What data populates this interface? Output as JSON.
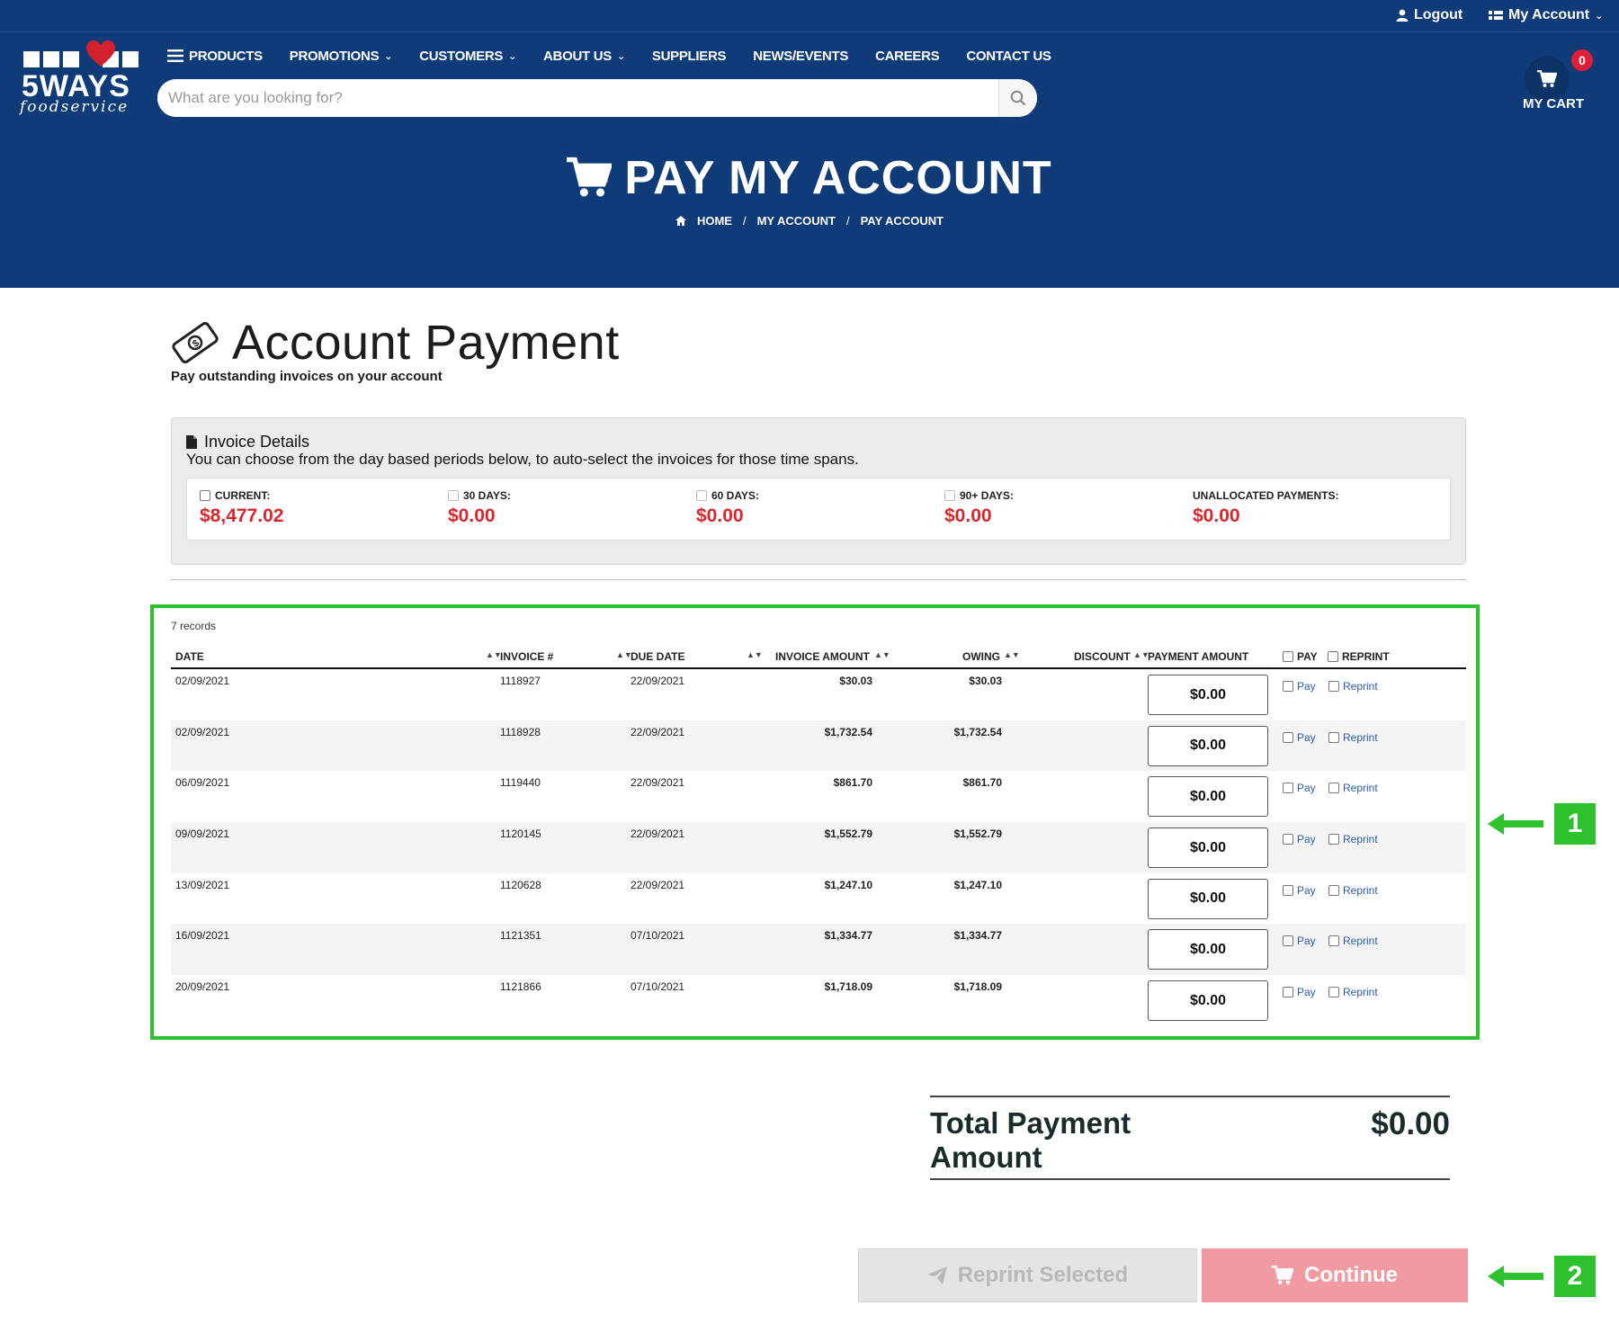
{
  "topbar": {
    "logout": "Logout",
    "my_account": "My Account"
  },
  "logo": {
    "brand": "5WAYS",
    "sub": "foodservice"
  },
  "nav": [
    {
      "label": "PRODUCTS",
      "menu": true,
      "dropdown": false
    },
    {
      "label": "PROMOTIONS",
      "menu": false,
      "dropdown": true
    },
    {
      "label": "CUSTOMERS",
      "menu": false,
      "dropdown": true
    },
    {
      "label": "ABOUT US",
      "menu": false,
      "dropdown": true
    },
    {
      "label": "SUPPLIERS",
      "menu": false,
      "dropdown": false
    },
    {
      "label": "NEWS/EVENTS",
      "menu": false,
      "dropdown": false
    },
    {
      "label": "CAREERS",
      "menu": false,
      "dropdown": false
    },
    {
      "label": "CONTACT US",
      "menu": false,
      "dropdown": false
    }
  ],
  "search": {
    "placeholder": "What are you looking for?",
    "value": ""
  },
  "cart": {
    "count": "0",
    "label": "MY CART"
  },
  "hero": {
    "title": "PAY MY ACCOUNT"
  },
  "breadcrumb": [
    "HOME",
    "MY ACCOUNT",
    "PAY ACCOUNT"
  ],
  "page": {
    "title": "Account Payment",
    "subtitle": "Pay outstanding invoices on your account"
  },
  "details": {
    "title": "Invoice Details",
    "description": "You can choose from the day based periods below, to auto-select the invoices for those time spans.",
    "periods": [
      {
        "label": "CURRENT:",
        "value": "$8,477.02",
        "checkbox": true
      },
      {
        "label": "30 DAYS:",
        "value": "$0.00",
        "checkbox": true
      },
      {
        "label": "60 DAYS:",
        "value": "$0.00",
        "checkbox": true
      },
      {
        "label": "90+ DAYS:",
        "value": "$0.00",
        "checkbox": true
      },
      {
        "label": "UNALLOCATED PAYMENTS:",
        "value": "$0.00",
        "checkbox": false
      }
    ]
  },
  "table": {
    "records": "7 records",
    "headers": {
      "date": "DATE",
      "invoice": "INVOICE #",
      "due_date": "DUE DATE",
      "invoice_amount": "INVOICE AMOUNT",
      "owing": "OWING",
      "discount": "DISCOUNT",
      "payment_amount": "PAYMENT AMOUNT",
      "pay": "PAY",
      "reprint": "REPRINT"
    },
    "pay_label": "Pay",
    "reprint_label": "Reprint",
    "rows": [
      {
        "date": "02/09/2021",
        "invoice": "1118927",
        "due": "22/09/2021",
        "amount": "$30.03",
        "owing": "$30.03",
        "discount": "",
        "payment": "$0.00"
      },
      {
        "date": "02/09/2021",
        "invoice": "1118928",
        "due": "22/09/2021",
        "amount": "$1,732.54",
        "owing": "$1,732.54",
        "discount": "",
        "payment": "$0.00"
      },
      {
        "date": "06/09/2021",
        "invoice": "1119440",
        "due": "22/09/2021",
        "amount": "$861.70",
        "owing": "$861.70",
        "discount": "",
        "payment": "$0.00"
      },
      {
        "date": "09/09/2021",
        "invoice": "1120145",
        "due": "22/09/2021",
        "amount": "$1,552.79",
        "owing": "$1,552.79",
        "discount": "",
        "payment": "$0.00"
      },
      {
        "date": "13/09/2021",
        "invoice": "1120628",
        "due": "22/09/2021",
        "amount": "$1,247.10",
        "owing": "$1,247.10",
        "discount": "",
        "payment": "$0.00"
      },
      {
        "date": "16/09/2021",
        "invoice": "1121351",
        "due": "07/10/2021",
        "amount": "$1,334.77",
        "owing": "$1,334.77",
        "discount": "",
        "payment": "$0.00"
      },
      {
        "date": "20/09/2021",
        "invoice": "1121866",
        "due": "07/10/2021",
        "amount": "$1,718.09",
        "owing": "$1,718.09",
        "discount": "",
        "payment": "$0.00"
      }
    ]
  },
  "total": {
    "label": "Total Payment Amount",
    "value": "$0.00"
  },
  "buttons": {
    "reprint": "Reprint Selected",
    "continue": "Continue"
  },
  "annotations": [
    "1",
    "2"
  ],
  "colors": {
    "header_bg": "#0f3b79",
    "accent_red": "#d9262c",
    "continue_bg": "#f29aa2",
    "annotation_green": "#2dc22d",
    "link_blue": "#2b5cab"
  }
}
